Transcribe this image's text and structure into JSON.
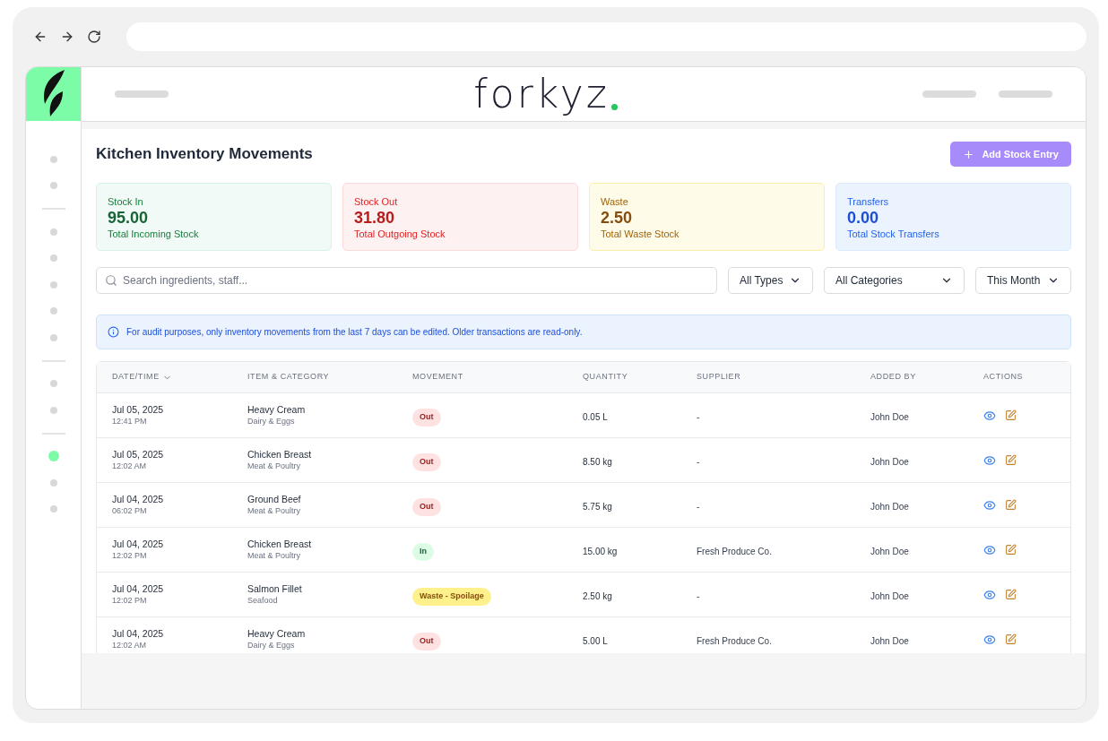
{
  "sidebar": {
    "groups": [
      {
        "items": [
          {
            "selected": false
          },
          {
            "selected": false
          }
        ]
      },
      {
        "items": [
          {
            "selected": false
          },
          {
            "selected": false
          },
          {
            "selected": false
          },
          {
            "selected": false
          },
          {
            "selected": false
          }
        ]
      },
      {
        "items": [
          {
            "selected": false
          },
          {
            "selected": false
          }
        ]
      },
      {
        "items": [
          {
            "selected": true
          },
          {
            "selected": false
          },
          {
            "selected": false
          }
        ]
      }
    ]
  },
  "header": {
    "logo": "forkyz"
  },
  "page": {
    "title": "Kitchen Inventory Movements",
    "add_button": "Add Stock Entry"
  },
  "cards": [
    {
      "kind": "in",
      "label": "Stock In",
      "value": "95.00",
      "caption": "Total Incoming Stock"
    },
    {
      "kind": "out",
      "label": "Stock Out",
      "value": "31.80",
      "caption": "Total Outgoing Stock"
    },
    {
      "kind": "waste",
      "label": "Waste",
      "value": "2.50",
      "caption": "Total Waste Stock"
    },
    {
      "kind": "transfer",
      "label": "Transfers",
      "value": "0.00",
      "caption": "Total Stock Transfers"
    }
  ],
  "filters": {
    "search": {
      "placeholder": "Search ingredients, staff..."
    },
    "selects": [
      "All Types",
      "All Categories",
      "This Month"
    ]
  },
  "notice": "For audit purposes, only inventory movements from the last 7 days can be edited. Older transactions are read-only.",
  "table": {
    "columns": [
      {
        "label": "DATE/TIME",
        "sorted": true
      },
      {
        "label": "ITEM & CATEGORY",
        "sorted": false
      },
      {
        "label": "MOVEMENT",
        "sorted": false
      },
      {
        "label": "QUANTITY",
        "sorted": false
      },
      {
        "label": "SUPPLIER",
        "sorted": false
      },
      {
        "label": "ADDED BY",
        "sorted": false
      },
      {
        "label": "ACTIONS",
        "sorted": false
      }
    ],
    "rows": [
      {
        "date": "Jul 05, 2025",
        "time": "12:41 PM",
        "item": "Heavy Cream",
        "category": "Dairy & Eggs",
        "movement": {
          "kind": "out",
          "label": "Out"
        },
        "quantity": "0.05 L",
        "supplier": "-",
        "added_by": "John Doe"
      },
      {
        "date": "Jul 05, 2025",
        "time": "12:02 AM",
        "item": "Chicken Breast",
        "category": "Meat & Poultry",
        "movement": {
          "kind": "out",
          "label": "Out"
        },
        "quantity": "8.50 kg",
        "supplier": "-",
        "added_by": "John Doe"
      },
      {
        "date": "Jul 04, 2025",
        "time": "06:02 PM",
        "item": "Ground Beef",
        "category": "Meat & Poultry",
        "movement": {
          "kind": "out",
          "label": "Out"
        },
        "quantity": "5.75 kg",
        "supplier": "-",
        "added_by": "John Doe"
      },
      {
        "date": "Jul 04, 2025",
        "time": "12:02 PM",
        "item": "Chicken Breast",
        "category": "Meat & Poultry",
        "movement": {
          "kind": "in",
          "label": "In"
        },
        "quantity": "15.00 kg",
        "supplier": "Fresh Produce Co.",
        "added_by": "John Doe"
      },
      {
        "date": "Jul 04, 2025",
        "time": "12:02 PM",
        "item": "Salmon Fillet",
        "category": "Seafood",
        "movement": {
          "kind": "waste",
          "label": "Waste - Spoilage"
        },
        "quantity": "2.50 kg",
        "supplier": "-",
        "added_by": "John Doe"
      },
      {
        "date": "Jul 04, 2025",
        "time": "12:02 AM",
        "item": "Heavy Cream",
        "category": "Dairy & Eggs",
        "movement": {
          "kind": "out",
          "label": "Out"
        },
        "quantity": "5.00 L",
        "supplier": "Fresh Produce Co.",
        "added_by": "John Doe"
      }
    ]
  }
}
